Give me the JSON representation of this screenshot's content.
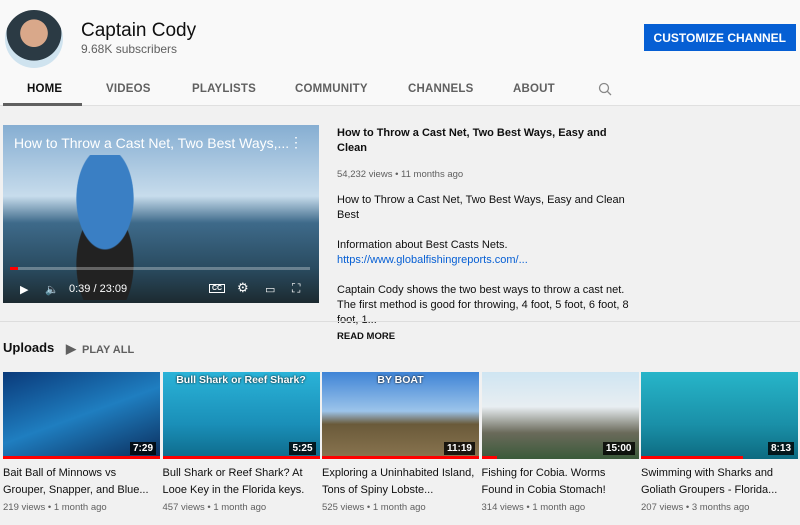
{
  "channel": {
    "name": "Captain Cody",
    "subscribers": "9.68K subscribers",
    "customize_label": "CUSTOMIZE CHANNEL"
  },
  "tabs": [
    {
      "label": "HOME",
      "active": true
    },
    {
      "label": "VIDEOS"
    },
    {
      "label": "PLAYLISTS"
    },
    {
      "label": "COMMUNITY"
    },
    {
      "label": "CHANNELS"
    },
    {
      "label": "ABOUT"
    }
  ],
  "featured": {
    "overlay_title": "How to Throw a Cast Net, Two Best Ways,...",
    "time": "0:39 / 23:09",
    "progress_percent": 2.8,
    "title": "How to Throw a Cast Net, Two Best Ways, Easy and Clean",
    "meta": "54,232 views • 11 months ago",
    "desc1": "How to Throw a Cast Net, Two Best Ways, Easy and Clean Best",
    "desc2": "Information about Best Casts Nets.",
    "link": "https://www.globalfishingreports.com/...",
    "desc3": "Captain Cody shows the two best ways to throw a cast net. The first method is good for throwing, 4 foot, 5 foot, 6 foot, 8 foot, 1...",
    "read_more": "READ MORE"
  },
  "uploads": {
    "title": "Uploads",
    "play_all": "PLAY ALL",
    "videos": [
      {
        "title": "Bait Ball of Minnows vs Grouper, Snapper, and Blue...",
        "meta": "219 views • 1 month ago",
        "duration": "7:29",
        "overlay": "",
        "bg": "linear-gradient(160deg,#0a3a7a,#1f7ec0 50%,#0b2c5a)"
      },
      {
        "title": "Bull Shark or Reef Shark? At Looe Key in the Florida keys.",
        "meta": "457 views • 1 month ago",
        "duration": "5:25",
        "overlay": "Bull Shark or Reef Shark?",
        "bg": "linear-gradient(180deg,#2ab3d8,#1a8fb8 60%,#0e6a8a)"
      },
      {
        "title": "Exploring a Uninhabited Island, Tons of Spiny Lobste...",
        "meta": "525 views • 1 month ago",
        "duration": "11:19",
        "overlay": "BY BOAT",
        "bg": "linear-gradient(180deg,#3f84d6,#9cc4ea 45%,#6a5a3a 60%,#8a7550)"
      },
      {
        "title": "Fishing for Cobia. Worms Found in Cobia Stomach!",
        "meta": "314 views • 1 month ago",
        "duration": "15:00",
        "overlay": "",
        "bg": "linear-gradient(180deg,#cfe5f2,#e8eef2 40%,#6a6a5a 70%,#3a5a3a)"
      },
      {
        "title": "Swimming with Sharks and Goliath Groupers - Florida...",
        "meta": "207 views • 3 months ago",
        "duration": "8:13",
        "overlay": "",
        "bg": "linear-gradient(180deg,#27b5c9,#1a90a8 60%,#0d6a80)"
      }
    ]
  }
}
